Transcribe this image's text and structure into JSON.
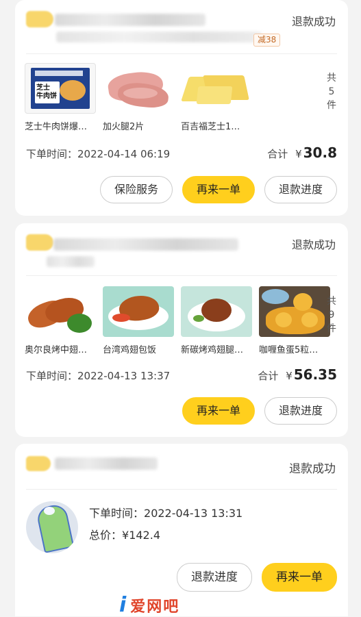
{
  "orders": [
    {
      "status": "退款成功",
      "coupon": "减38",
      "products": [
        {
          "name": "芝士牛肉饼爆…",
          "pack_text": "芝士\n牛肉饼"
        },
        {
          "name": "加火腿2片"
        },
        {
          "name": "百吉福芝士1…"
        }
      ],
      "count_label": "共\n5\n件",
      "order_time_label": "下单时间：",
      "order_time": "2022-04-14 06:19",
      "total_label": "合计",
      "currency": "¥",
      "total_amount": "30.8",
      "buttons": {
        "insurance": "保险服务",
        "reorder": "再来一单",
        "refund_progress": "退款进度"
      }
    },
    {
      "status": "退款成功",
      "products": [
        {
          "name": "奥尔良烤中翅…"
        },
        {
          "name": "台湾鸡翅包饭"
        },
        {
          "name": "新碳烤鸡翅腿…"
        },
        {
          "name": "咖喱鱼蛋5粒…"
        }
      ],
      "count_label": "共\n9\n件",
      "order_time_label": "下单时间：",
      "order_time": "2022-04-13 13:37",
      "total_label": "合计",
      "currency": "¥",
      "total_amount": "56.35",
      "buttons": {
        "reorder": "再来一单",
        "refund_progress": "退款进度"
      }
    },
    {
      "status": "退款成功",
      "order_time_label": "下单时间：",
      "order_time": "2022-04-13 13:31",
      "total_label": "总价：",
      "total_amount": "¥142.4",
      "buttons": {
        "refund_progress": "退款进度",
        "reorder": "再来一单"
      }
    }
  ],
  "watermark": {
    "i": "i",
    "text": "爱网吧"
  },
  "colors": {
    "primary": "#ffcf1d",
    "background": "#f3f3f3"
  }
}
